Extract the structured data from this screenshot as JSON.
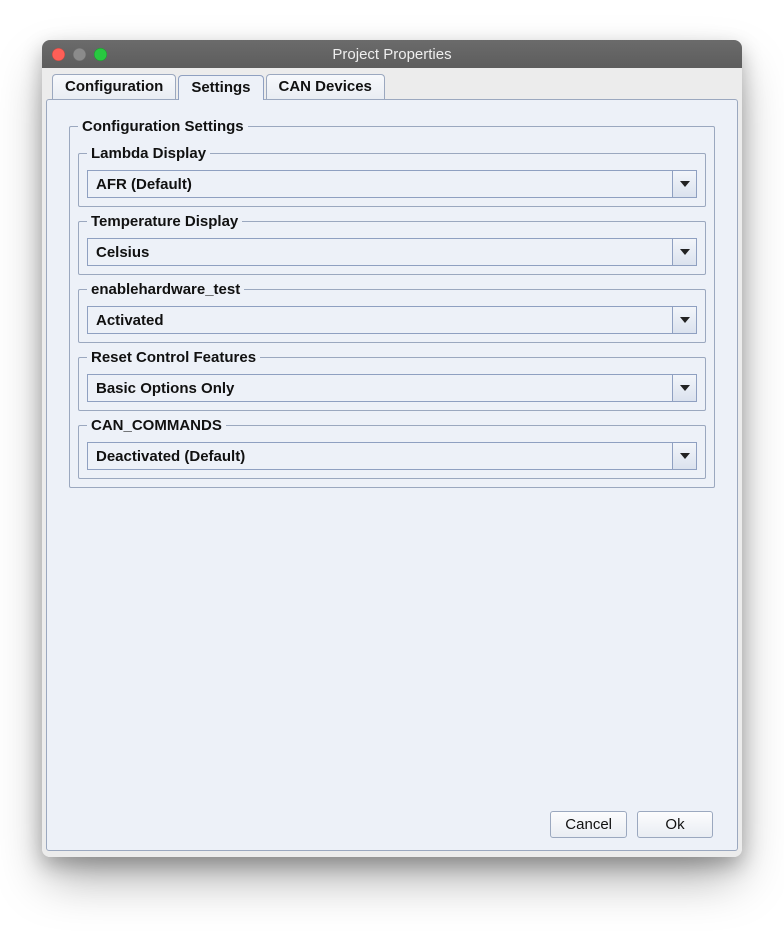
{
  "window": {
    "title": "Project Properties"
  },
  "tabs": [
    {
      "label": "Configuration"
    },
    {
      "label": "Settings"
    },
    {
      "label": "CAN Devices"
    }
  ],
  "active_tab_index": 1,
  "group": {
    "title": "Configuration Settings",
    "fields": [
      {
        "label": "Lambda Display",
        "value": "AFR (Default)"
      },
      {
        "label": "Temperature Display",
        "value": "Celsius"
      },
      {
        "label": "enablehardware_test",
        "value": "Activated"
      },
      {
        "label": "Reset Control Features",
        "value": "Basic Options Only"
      },
      {
        "label": "CAN_COMMANDS",
        "value": "Deactivated (Default)"
      }
    ]
  },
  "buttons": {
    "cancel": "Cancel",
    "ok": "Ok"
  }
}
